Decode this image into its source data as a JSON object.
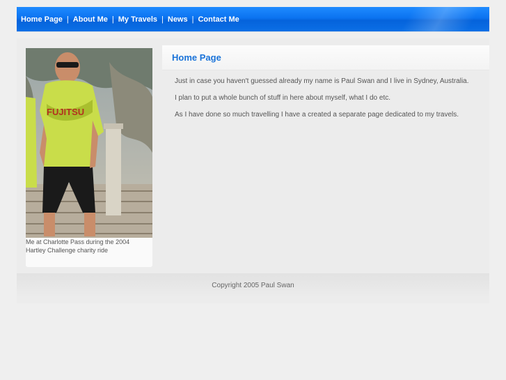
{
  "nav": {
    "items": [
      {
        "label": "Home Page"
      },
      {
        "label": "About Me"
      },
      {
        "label": "My Travels"
      },
      {
        "label": "News"
      },
      {
        "label": "Contact Me"
      }
    ],
    "separator": "|"
  },
  "sidebar": {
    "photo_caption": "Me at Charlotte Pass during the 2004 Hartley Challenge charity ride",
    "jersey_text": "FUJITSU"
  },
  "main": {
    "title": "Home Page",
    "paragraphs": [
      "Just in case you haven't guessed already my name is Paul Swan and I live in Sydney, Australia.",
      "I plan to put a whole bunch of stuff in here about myself, what I do etc.",
      "As I have done so much travelling I have a created a separate page dedicated to my travels."
    ]
  },
  "footer": {
    "copyright": "Copyright 2005 Paul Swan"
  },
  "colors": {
    "nav_blue": "#0b73f0",
    "heading_blue": "#1a73d9",
    "page_bg": "#efefef"
  }
}
